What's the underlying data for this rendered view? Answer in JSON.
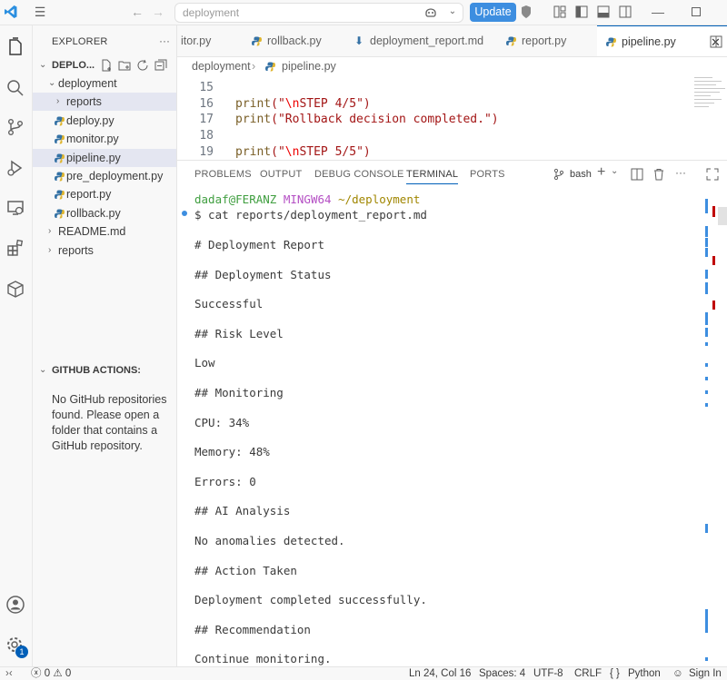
{
  "titlebar": {
    "search_text": "deployment",
    "update_label": "Update"
  },
  "sidebar": {
    "explorer_title": "EXPLORER",
    "root_label": "DEPLO...",
    "tree": [
      {
        "label": "deployment",
        "indent": 1,
        "type": "folder-open",
        "selected": false
      },
      {
        "label": "reports",
        "indent": 2,
        "type": "folder-closed",
        "selected": true
      },
      {
        "label": "deploy.py",
        "indent": 2,
        "type": "python",
        "selected": false
      },
      {
        "label": "monitor.py",
        "indent": 2,
        "type": "python",
        "selected": false
      },
      {
        "label": "pipeline.py",
        "indent": 2,
        "type": "python",
        "selected": true
      },
      {
        "label": "pre_deployment.py",
        "indent": 2,
        "type": "python",
        "selected": false
      },
      {
        "label": "report.py",
        "indent": 2,
        "type": "python",
        "selected": false
      },
      {
        "label": "rollback.py",
        "indent": 2,
        "type": "python",
        "selected": false
      },
      {
        "label": "README.md",
        "indent": 1,
        "type": "folder-closed",
        "selected": false
      },
      {
        "label": "reports",
        "indent": 1,
        "type": "folder-closed",
        "selected": false
      }
    ],
    "github_title": "GITHUB ACTIONS:",
    "github_message": "No GitHub repositories found. Please open a folder that contains a GitHub repository."
  },
  "tabs": [
    {
      "label": "itor.py",
      "icon": "python"
    },
    {
      "label": "rollback.py",
      "icon": "python"
    },
    {
      "label": "deployment_report.md",
      "icon": "download"
    },
    {
      "label": "report.py",
      "icon": "python"
    },
    {
      "label": "pipeline.py",
      "icon": "python",
      "active": true
    }
  ],
  "breadcrumb": {
    "folder": "deployment",
    "file": "pipeline.py"
  },
  "code": {
    "line_numbers": [
      "15",
      "16",
      "17",
      "18",
      "19"
    ],
    "line16_fn": "print",
    "line16_str_pre": "(\"",
    "line16_esc": "\\n",
    "line16_str_post": "STEP 4/5\")",
    "line17_fn": "print",
    "line17_str": "(\"Rollback decision completed.\")",
    "line19_fn": "print",
    "line19_str_pre": "(\"",
    "line19_esc": "\\n",
    "line19_str_post": "STEP 5/5\")"
  },
  "panel": {
    "tabs": [
      "PROBLEMS",
      "OUTPUT",
      "DEBUG CONSOLE",
      "TERMINAL",
      "PORTS"
    ],
    "shell_label": "bash"
  },
  "terminal": {
    "prompt_user": "dadaf@FERANZ",
    "prompt_env": "MINGW64",
    "prompt_path": "~/deployment",
    "command": "$ cat reports/deployment_report.md",
    "lines": [
      "# Deployment Report",
      "## Deployment Status",
      "Successful",
      "## Risk Level",
      "Low",
      "## Monitoring",
      "CPU: 34%",
      "Memory: 48%",
      "Errors: 0",
      "## AI Analysis",
      "No anomalies detected.",
      "## Action Taken",
      "Deployment completed successfully.",
      "## Recommendation",
      "Continue monitoring."
    ]
  },
  "statusbar": {
    "errors": "0",
    "warnings": "0",
    "position": "Ln 24, Col 16",
    "spaces": "Spaces: 4",
    "encoding": "UTF-8",
    "eol": "CRLF",
    "language": "Python",
    "signin": "Sign In",
    "notification_count": "1"
  },
  "colors": {
    "accent": "#005fb8",
    "update_button": "#3d8ee0",
    "prompt_user": "#3f9e3f",
    "prompt_env": "#b44fc4",
    "prompt_path": "#a08600"
  }
}
